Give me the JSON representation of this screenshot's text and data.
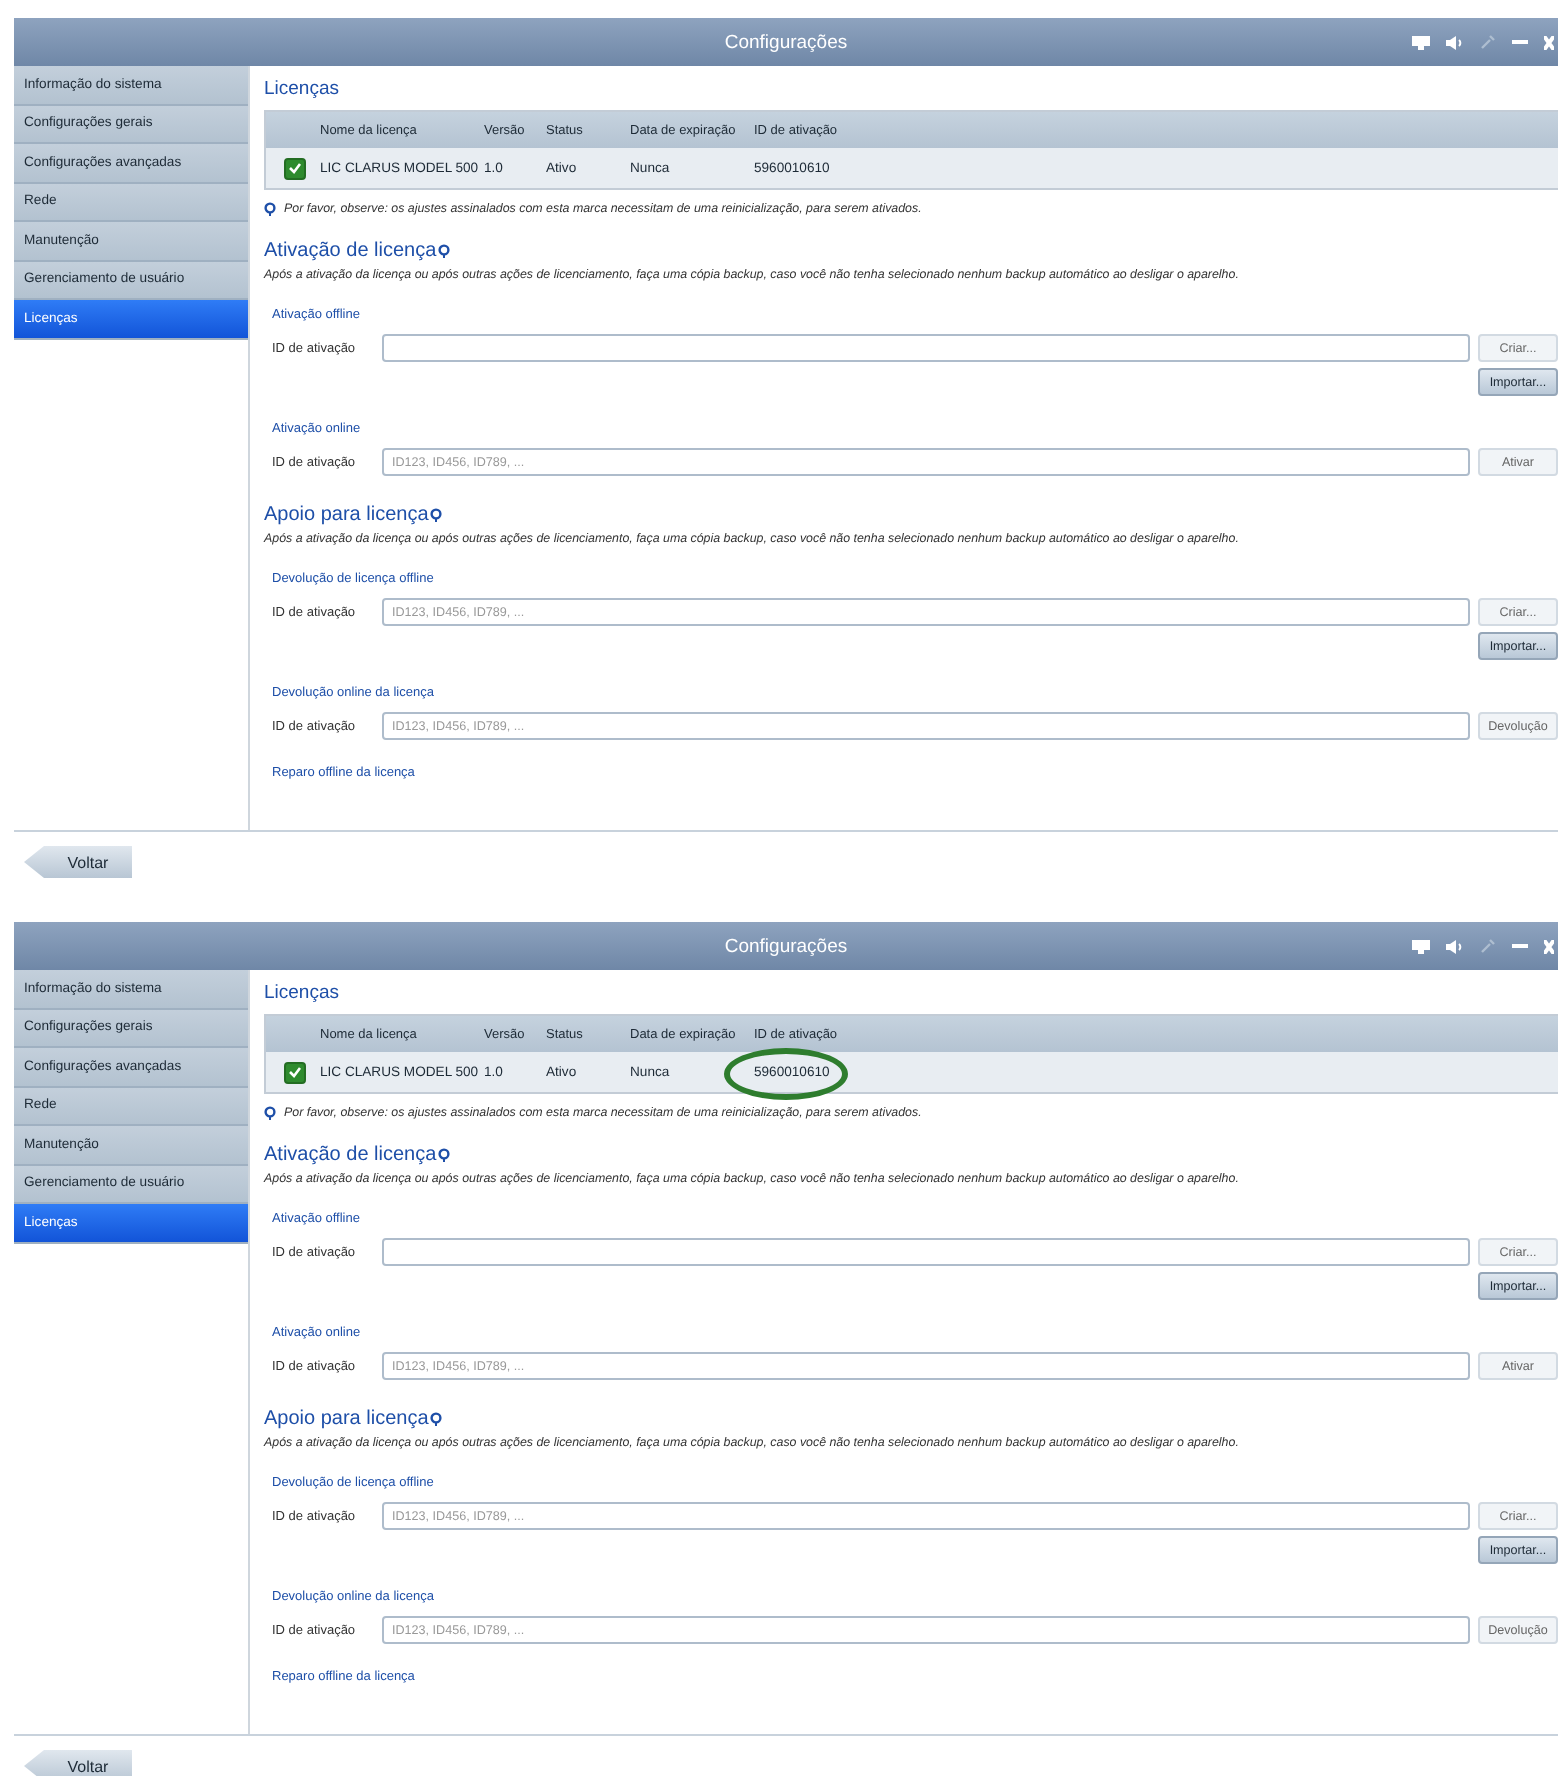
{
  "screens": [
    {
      "window": {
        "title": "Configurações"
      },
      "sidebar": {
        "items": [
          {
            "label": "Informação do sistema",
            "selected": false
          },
          {
            "label": "Configurações gerais",
            "selected": false
          },
          {
            "label": "Configurações avançadas",
            "selected": false
          },
          {
            "label": "Rede",
            "selected": false
          },
          {
            "label": "Manutenção",
            "selected": false
          },
          {
            "label": "Gerenciamento de usuário",
            "selected": false
          },
          {
            "label": "Licenças",
            "selected": true
          }
        ]
      },
      "page_title": "Licenças",
      "table": {
        "columns": [
          "Nome da licença",
          "Versão",
          "Status",
          "Data de expiração",
          "ID de ativação"
        ],
        "rows": [
          {
            "checked": true,
            "highlighted": false,
            "cells": [
              "LIC CLARUS MODEL 500",
              "1.0",
              "Ativo",
              "Nunca",
              "5960010610"
            ]
          }
        ]
      },
      "note": "Por favor, observe: os ajustes assinalados com esta marca necessitam de uma reinicialização, para serem ativados.",
      "sections": [
        {
          "title": "Ativação de licença",
          "description": "Após a ativação da licença ou após outras ações de licenciamento, faça uma cópia backup, caso você não tenha selecionado nenhum backup automático ao desligar o aparelho.",
          "groups": [
            {
              "title": "Ativação offline",
              "label": "ID de ativação",
              "side_button": {
                "label": "Criar...",
                "disabled": true
              },
              "below_button": {
                "label": "Importar...",
                "disabled": false
              }
            },
            {
              "title": "Ativação online",
              "label": "ID de ativação",
              "field": {
                "placeholder": "ID123, ID456, ID789, ..."
              },
              "side_button": {
                "label": "Ativar",
                "disabled": true
              }
            }
          ]
        },
        {
          "title": "Apoio para licença",
          "description": "Após a ativação da licença ou após outras ações de licenciamento, faça uma cópia backup, caso você não tenha selecionado nenhum backup automático ao desligar o aparelho.",
          "groups": [
            {
              "title": "Devolução de licença offline",
              "label": "ID de ativação",
              "field": {
                "placeholder": "ID123, ID456, ID789, ..."
              },
              "side_button": {
                "label": "Criar...",
                "disabled": true
              },
              "below_button": {
                "label": "Importar...",
                "disabled": false
              }
            },
            {
              "title": "Devolução online da licença",
              "label": "ID de ativação",
              "field": {
                "placeholder": "ID123, ID456, ID789, ..."
              },
              "side_button": {
                "label": "Devolução",
                "disabled": true
              }
            },
            {
              "title": "Reparo offline da licença"
            }
          ]
        }
      ],
      "back_button": "Voltar"
    },
    {
      "window": {
        "title": "Configurações"
      },
      "sidebar": {
        "items": [
          {
            "label": "Informação do sistema",
            "selected": false
          },
          {
            "label": "Configurações gerais",
            "selected": false
          },
          {
            "label": "Configurações avançadas",
            "selected": false
          },
          {
            "label": "Rede",
            "selected": false
          },
          {
            "label": "Manutenção",
            "selected": false
          },
          {
            "label": "Gerenciamento de usuário",
            "selected": false
          },
          {
            "label": "Licenças",
            "selected": true
          }
        ]
      },
      "page_title": "Licenças",
      "table": {
        "columns": [
          "Nome da licença",
          "Versão",
          "Status",
          "Data de expiração",
          "ID de ativação"
        ],
        "rows": [
          {
            "checked": true,
            "highlighted": true,
            "cells": [
              "LIC CLARUS MODEL 500",
              "1.0",
              "Ativo",
              "Nunca",
              "5960010610"
            ]
          }
        ]
      },
      "note": "Por favor, observe: os ajustes assinalados com esta marca necessitam de uma reinicialização, para serem ativados.",
      "sections": [
        {
          "title": "Ativação de licença",
          "description": "Após a ativação da licença ou após outras ações de licenciamento, faça uma cópia backup, caso você não tenha selecionado nenhum backup automático ao desligar o aparelho.",
          "groups": [
            {
              "title": "Ativação offline",
              "label": "ID de ativação",
              "side_button": {
                "label": "Criar...",
                "disabled": true
              },
              "below_button": {
                "label": "Importar...",
                "disabled": false
              }
            },
            {
              "title": "Ativação online",
              "label": "ID de ativação",
              "field": {
                "placeholder": "ID123, ID456, ID789, ..."
              },
              "side_button": {
                "label": "Ativar",
                "disabled": true
              }
            }
          ]
        },
        {
          "title": "Apoio para licença",
          "description": "Após a ativação da licença ou após outras ações de licenciamento, faça uma cópia backup, caso você não tenha selecionado nenhum backup automático ao desligar o aparelho.",
          "groups": [
            {
              "title": "Devolução de licença offline",
              "label": "ID de ativação",
              "field": {
                "placeholder": "ID123, ID456, ID789, ..."
              },
              "side_button": {
                "label": "Criar...",
                "disabled": true
              },
              "below_button": {
                "label": "Importar...",
                "disabled": false
              }
            },
            {
              "title": "Devolução online da licença",
              "label": "ID de ativação",
              "field": {
                "placeholder": "ID123, ID456, ID789, ..."
              },
              "side_button": {
                "label": "Devolução",
                "disabled": true
              }
            },
            {
              "title": "Reparo offline da licença"
            }
          ]
        }
      ],
      "back_button": "Voltar"
    }
  ]
}
